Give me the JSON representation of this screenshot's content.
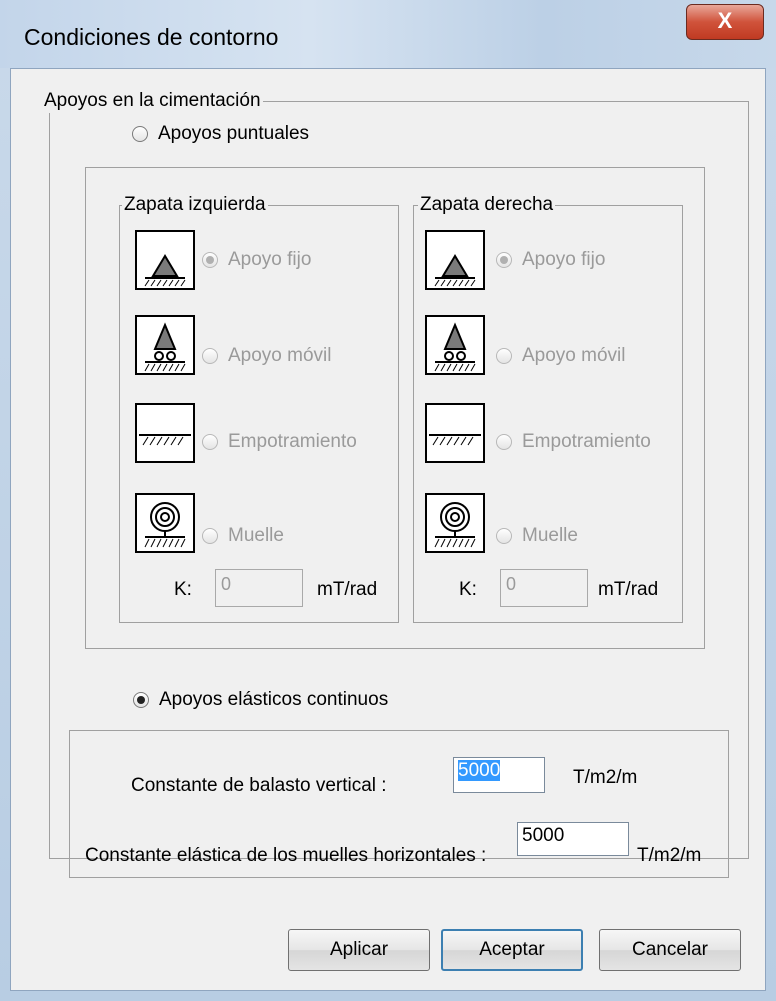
{
  "window": {
    "title": "Condiciones de contorno",
    "close_glyph": "X"
  },
  "apoyos_group": {
    "legend": "Apoyos en la cimentación"
  },
  "radio_puntuales": {
    "label": "Apoyos puntuales",
    "checked": false
  },
  "zapata_izquierda": {
    "legend": "Zapata izquierda",
    "options": [
      {
        "label": "Apoyo fijo",
        "icon": "fixed-support-icon",
        "checked": true
      },
      {
        "label": "Apoyo móvil",
        "icon": "roller-support-icon",
        "checked": false
      },
      {
        "label": "Empotramiento",
        "icon": "clamped-support-icon",
        "checked": false
      },
      {
        "label": "Muelle",
        "icon": "spring-support-icon",
        "checked": false
      }
    ],
    "k_label": "K:",
    "k_value": "0",
    "k_unit": "mT/rad"
  },
  "zapata_derecha": {
    "legend": "Zapata derecha",
    "options": [
      {
        "label": "Apoyo fijo",
        "icon": "fixed-support-icon",
        "checked": true
      },
      {
        "label": "Apoyo móvil",
        "icon": "roller-support-icon",
        "checked": false
      },
      {
        "label": "Empotramiento",
        "icon": "clamped-support-icon",
        "checked": false
      },
      {
        "label": "Muelle",
        "icon": "spring-support-icon",
        "checked": false
      }
    ],
    "k_label": "K:",
    "k_value": "0",
    "k_unit": "mT/rad"
  },
  "radio_elasticos": {
    "label": "Apoyos elásticos continuos",
    "checked": true
  },
  "balasto": {
    "label": "Constante de balasto vertical :",
    "value": "5000",
    "unit": "T/m2/m"
  },
  "muelles_h": {
    "label": "Constante elástica de los muelles horizontales :",
    "value": "5000",
    "unit": "T/m2/m"
  },
  "buttons": {
    "apply": "Aplicar",
    "accept": "Aceptar",
    "cancel": "Cancelar"
  },
  "colors": {
    "selection": "#3399ff",
    "close": "#c8452c",
    "dialog_bg": "#f0f0f0"
  }
}
